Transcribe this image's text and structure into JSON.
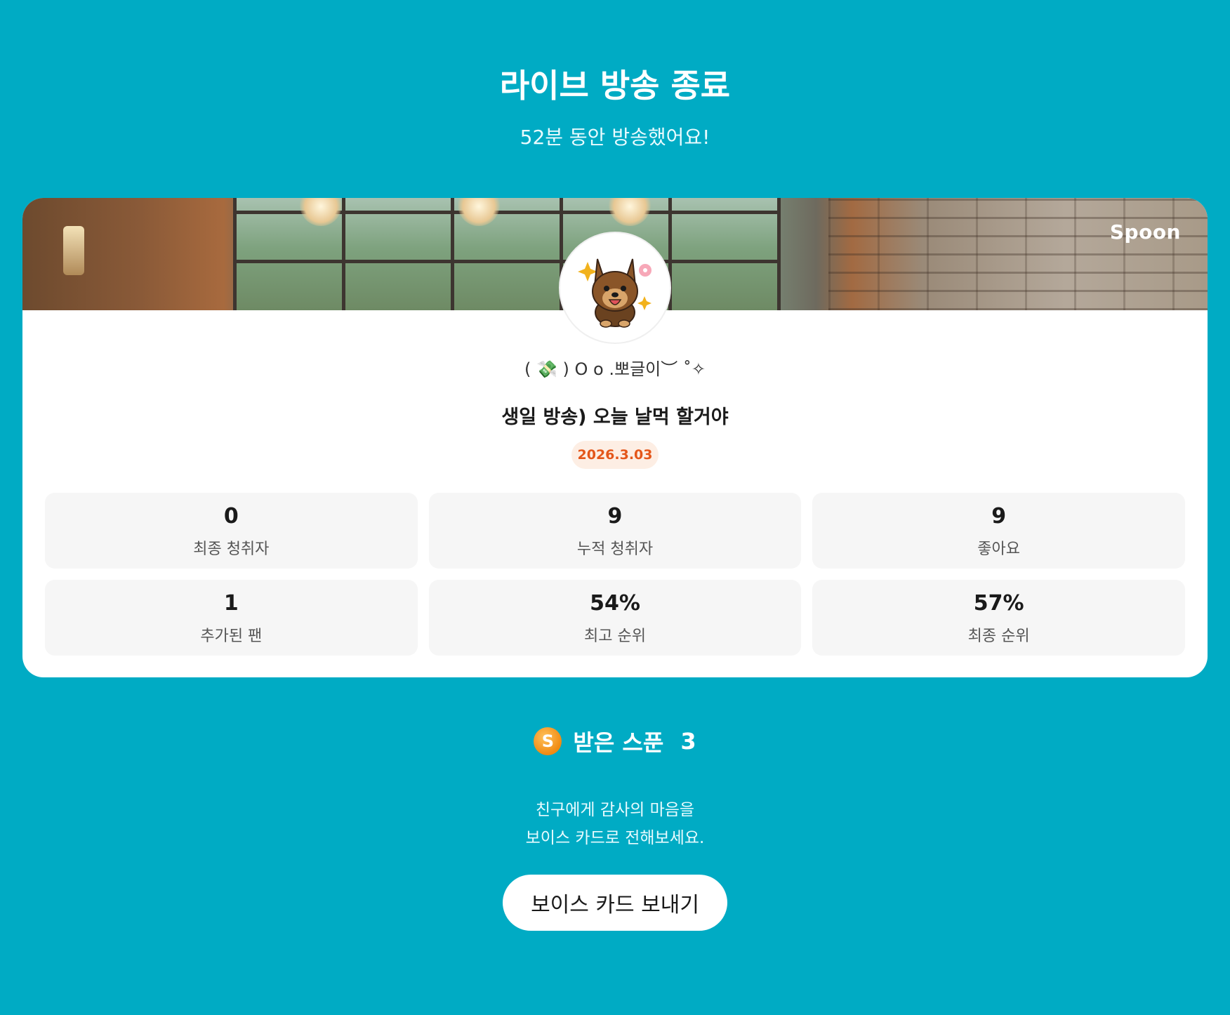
{
  "header": {
    "title": "라이브 방송 종료",
    "subtitle": "52분 동안 방송했어요!"
  },
  "card": {
    "brand": "Spoon",
    "avatar_icon": "puppy-avatar-icon",
    "nickname": "( 💸 ) O o .뽀글이︶ ˚✧",
    "live_title": "생일 방송) 오늘 날먹 할거야",
    "date": "2026.3.03",
    "stats": [
      {
        "value": "0",
        "label": "최종 청취자"
      },
      {
        "value": "9",
        "label": "누적 청취자"
      },
      {
        "value": "9",
        "label": "좋아요"
      },
      {
        "value": "1",
        "label": "추가된 팬"
      },
      {
        "value": "54%",
        "label": "최고 순위"
      },
      {
        "value": "57%",
        "label": "최종 순위"
      }
    ]
  },
  "spoons": {
    "coin_glyph": "S",
    "label": "받은 스푼",
    "count": "3"
  },
  "thanks": {
    "line1": "친구에게 감사의 마음을",
    "line2": "보이스 카드로 전해보세요."
  },
  "voice_card_button": "보이스 카드 보내기",
  "colors": {
    "background": "#00abc4",
    "date_badge_text": "#e4561a",
    "coin": "#f08a12"
  }
}
